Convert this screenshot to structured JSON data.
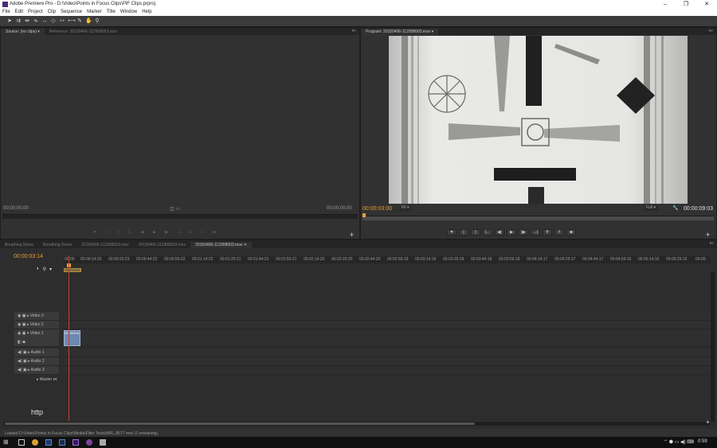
{
  "window": {
    "title": "Adobe Premiere Pro - D:\\Video\\Points in Focus Clips\\PiF Clips.prproj",
    "controls": [
      "–",
      "❐",
      "✕"
    ]
  },
  "menu": [
    "File",
    "Edit",
    "Project",
    "Clip",
    "Sequence",
    "Marker",
    "Title",
    "Window",
    "Help"
  ],
  "tools": [
    "selection-tool-icon",
    "track-select-tool-icon",
    "ripple-edit-tool-icon",
    "rolling-edit-tool-icon",
    "rate-stretch-tool-icon",
    "razor-tool-icon",
    "slip-tool-icon",
    "slide-tool-icon",
    "pen-tool-icon",
    "hand-tool-icon",
    "zoom-tool-icon"
  ],
  "source_panel": {
    "tabs": [
      "Source: (no clips) ▾",
      "Reference: 20150406-112908003.mov"
    ],
    "timecode_left": "00;00;00;00",
    "timecode_right": "00;00;00;00"
  },
  "program_panel": {
    "tab": "Program: 20150406-112908003.mov ▾",
    "timecode_current": "00:00:03:00",
    "fit": "Fit",
    "quality": "Full",
    "timecode_duration": "00:00:09:03"
  },
  "timeline": {
    "tabs": [
      "Breathing Demo",
      "Breathing Demo",
      "20150406-112908003.mov",
      "20150406-112908003.mov",
      "20150406-112908003.mov ✕"
    ],
    "timecode": "00:00:03:14",
    "ruler": [
      "00:00",
      "00:00:14:23",
      "00:00:29:23",
      "00:00:44:22",
      "00:00:59:22",
      "00:01:14:22",
      "00:01:29:21",
      "00:01:44:21",
      "00:01:59:21",
      "00:02:14:20",
      "00:02:29:20",
      "00:02:44:20",
      "00:02:59:19",
      "00:03:14:19",
      "00:03:29:18",
      "00:03:44:18",
      "00:03:59:18",
      "00:04:14:17",
      "00:04:29:17",
      "00:04:44:17",
      "00:04:59:16",
      "00:05:14:16",
      "00:05:29:16",
      "00:05:"
    ],
    "tracks": [
      {
        "label": "Video 3"
      },
      {
        "label": "Video 2"
      },
      {
        "label": "Video 1"
      },
      {
        "label": "Audio 1"
      },
      {
        "label": "Audio 2"
      },
      {
        "label": "Audio 3"
      },
      {
        "label": "Master"
      }
    ],
    "clip_label": "20150406-"
  },
  "status_text": "Loaded D:\\Video\\Points in Focus Clips\\Media\\Filter Tests\\IMG_8577.mov (1 remaining).",
  "overlay_text": "http",
  "taskbar": {
    "clock": "0:59"
  },
  "colors": {
    "accent_timecode": "#e8a038",
    "playhead": "#c04030",
    "clip": "#6f88b0"
  }
}
